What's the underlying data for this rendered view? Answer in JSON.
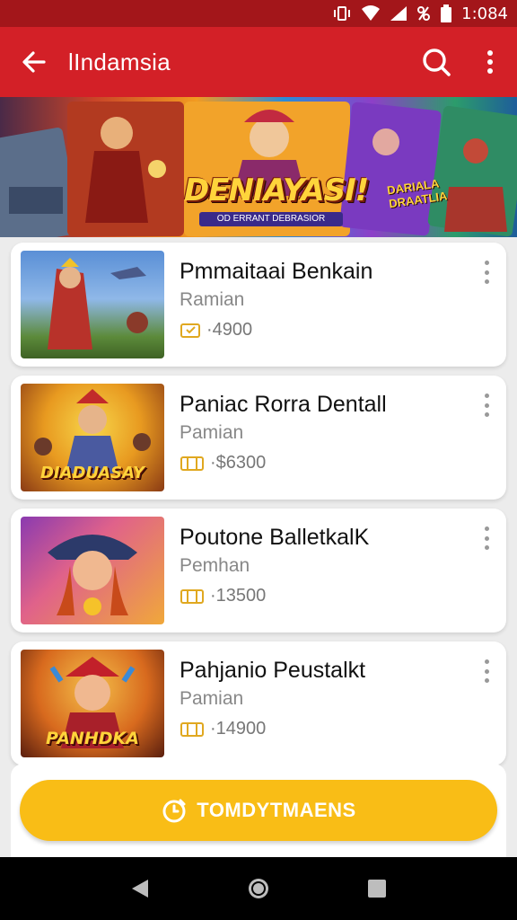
{
  "status_bar": {
    "time": "1:084"
  },
  "app_bar": {
    "title": "lIndamsia"
  },
  "banner": {
    "title": "DENIAYASI!",
    "subtitle": "OD ERRANT DEBRASIOR",
    "side_title": "DARIALA DRAATLIA"
  },
  "games": [
    {
      "name": "Pmmaitaai Benkain",
      "publisher": "Ramian",
      "price": "·4900",
      "thumb_text": ""
    },
    {
      "name": "Paniac Rorra Dentall",
      "publisher": "Pamian",
      "price": "·$6300",
      "thumb_text": "DIADUASAY"
    },
    {
      "name": "Poutone BalletkalK",
      "publisher": "Pemhan",
      "price": "·13500",
      "thumb_text": ""
    },
    {
      "name": "Pahjanio Peustalkt",
      "publisher": "Pamian",
      "price": "·14900",
      "thumb_text": "PANHDKA"
    }
  ],
  "cta": {
    "label": "TOMDYTMAENS"
  },
  "colors": {
    "primary": "#d32027",
    "status": "#a3161a",
    "accent": "#f9bd16"
  },
  "icons": [
    "back-arrow-icon",
    "search-icon",
    "more-vert-icon",
    "ticket-icon",
    "timer-icon"
  ]
}
